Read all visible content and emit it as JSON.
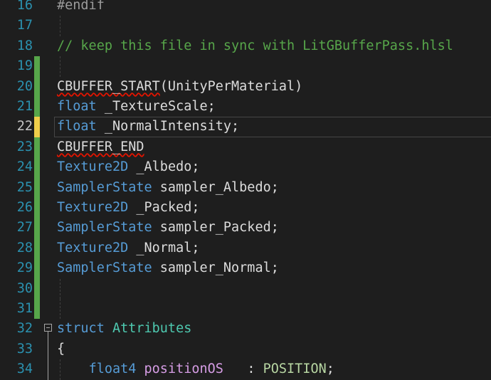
{
  "theme": {
    "background": "#1e1e1e",
    "line_number_color": "#2b91af",
    "current_line_number_color": "#c6c6c6",
    "change_bar_saved": "#57a64a",
    "change_bar_unsaved": "#efce4a"
  },
  "lines": [
    {
      "num": "16",
      "change": "none",
      "tokens": [
        {
          "t": "#endif",
          "c": "pp"
        }
      ]
    },
    {
      "num": "17",
      "change": "none",
      "guide": true,
      "tokens": []
    },
    {
      "num": "18",
      "change": "none",
      "tokens": [
        {
          "t": "// keep this file in sync with LitGBufferPass.hlsl",
          "c": "comment"
        }
      ]
    },
    {
      "num": "19",
      "change": "saved",
      "guide": true,
      "tokens": []
    },
    {
      "num": "20",
      "change": "saved",
      "tokens": [
        {
          "t": "CBUFFER_START",
          "c": "macro",
          "squiggle": true
        },
        {
          "t": "(UnityPerMaterial)",
          "c": "punct"
        }
      ]
    },
    {
      "num": "21",
      "change": "saved",
      "tokens": [
        {
          "t": "float",
          "c": "kw"
        },
        {
          "t": " _TextureScale;",
          "c": "ident"
        }
      ]
    },
    {
      "num": "22",
      "change": "unsaved",
      "current": true,
      "tokens": [
        {
          "t": "float",
          "c": "kw"
        },
        {
          "t": " _NormalIntensity;",
          "c": "ident"
        }
      ]
    },
    {
      "num": "23",
      "change": "saved",
      "tokens": [
        {
          "t": "CBUFFER_END",
          "c": "macro",
          "squiggle": true
        }
      ]
    },
    {
      "num": "24",
      "change": "saved",
      "tokens": [
        {
          "t": "Texture2D",
          "c": "kw"
        },
        {
          "t": " _Albedo;",
          "c": "ident"
        }
      ]
    },
    {
      "num": "25",
      "change": "saved",
      "tokens": [
        {
          "t": "SamplerState",
          "c": "kw"
        },
        {
          "t": " sampler_Albedo;",
          "c": "ident"
        }
      ]
    },
    {
      "num": "26",
      "change": "saved",
      "tokens": [
        {
          "t": "Texture2D",
          "c": "kw"
        },
        {
          "t": " _Packed;",
          "c": "ident"
        }
      ]
    },
    {
      "num": "27",
      "change": "saved",
      "tokens": [
        {
          "t": "SamplerState",
          "c": "kw"
        },
        {
          "t": " sampler_Packed;",
          "c": "ident"
        }
      ]
    },
    {
      "num": "28",
      "change": "saved",
      "tokens": [
        {
          "t": "Texture2D",
          "c": "kw"
        },
        {
          "t": " _Normal;",
          "c": "ident"
        }
      ]
    },
    {
      "num": "29",
      "change": "saved",
      "tokens": [
        {
          "t": "SamplerState",
          "c": "kw"
        },
        {
          "t": " sampler_Normal;",
          "c": "ident"
        }
      ]
    },
    {
      "num": "30",
      "change": "saved",
      "guide": true,
      "tokens": []
    },
    {
      "num": "31",
      "change": "saved",
      "guide": true,
      "tokens": []
    },
    {
      "num": "32",
      "change": "none",
      "fold": "start",
      "tokens": [
        {
          "t": "struct",
          "c": "kw"
        },
        {
          "t": " Attributes",
          "c": "type"
        }
      ]
    },
    {
      "num": "33",
      "change": "none",
      "fold": "line",
      "tokens": [
        {
          "t": "{",
          "c": "punct"
        }
      ]
    },
    {
      "num": "34",
      "change": "none",
      "fold": "line",
      "guide": true,
      "tokens": [
        {
          "t": "    ",
          "c": "ident"
        },
        {
          "t": "float4",
          "c": "kw"
        },
        {
          "t": " ",
          "c": "ident"
        },
        {
          "t": "positionOS",
          "c": "param"
        },
        {
          "t": "   : ",
          "c": "ident"
        },
        {
          "t": "POSITION",
          "c": "sem"
        },
        {
          "t": ";",
          "c": "punct"
        }
      ]
    }
  ]
}
